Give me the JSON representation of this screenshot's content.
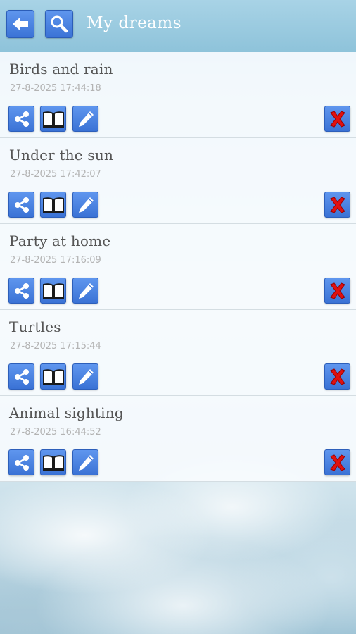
{
  "header": {
    "title": "My dreams",
    "back_icon": "arrow-left-icon",
    "search_icon": "magnifier-icon"
  },
  "dreams": [
    {
      "title": "Birds and rain",
      "date": "27-8-2025  17:44:18"
    },
    {
      "title": "Under the sun",
      "date": "27-8-2025  17:42:07"
    },
    {
      "title": "Party at home",
      "date": "27-8-2025  17:16:09"
    },
    {
      "title": "Turtles",
      "date": "27-8-2025  17:15:44"
    },
    {
      "title": "Animal sighting",
      "date": "27-8-2025  16:44:52"
    }
  ],
  "actions": {
    "share_icon": "share-icon",
    "read_icon": "open-book-icon",
    "edit_icon": "pencil-icon",
    "delete_icon": "red-x-icon"
  },
  "colors": {
    "button_blue": "#3b73d6",
    "delete_red": "#e01010",
    "header_bg": "#8ec3da"
  }
}
